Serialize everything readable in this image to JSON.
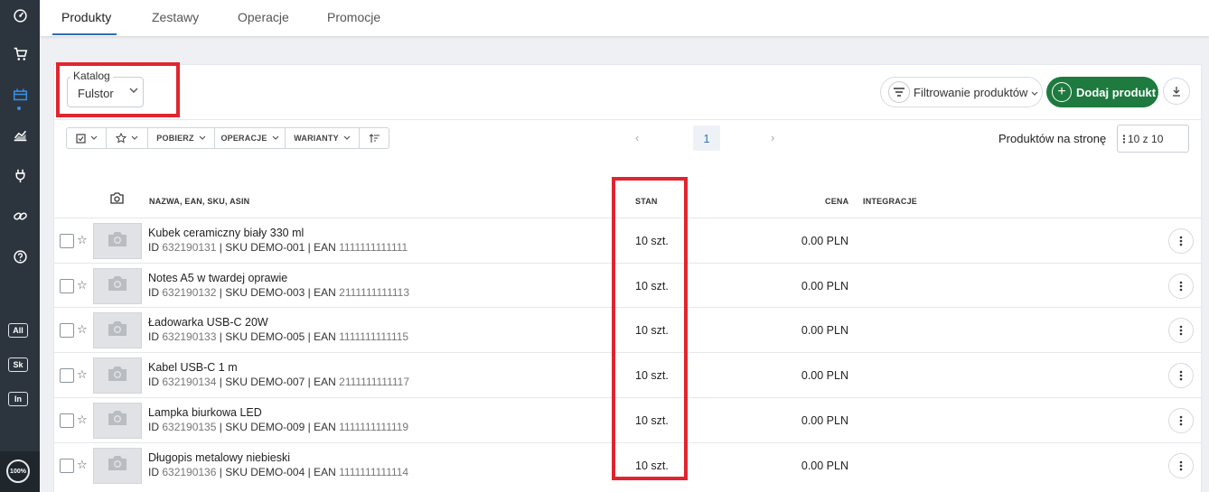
{
  "sidebar": {
    "items": [
      {
        "icon": "dashboard-icon"
      },
      {
        "icon": "cart-icon"
      },
      {
        "icon": "products-icon"
      },
      {
        "icon": "stats-icon"
      },
      {
        "icon": "plug-icon"
      },
      {
        "icon": "link-icon"
      },
      {
        "icon": "help-icon"
      }
    ],
    "tags": [
      "All",
      "Sk",
      "In"
    ],
    "progress": "100%"
  },
  "tabs": [
    "Produkty",
    "Zestawy",
    "Operacje",
    "Promocje"
  ],
  "catalog": {
    "legend": "Katalog",
    "value": "Fulstor"
  },
  "header_actions": {
    "filter_label": "Filtrowanie produktów",
    "add_label": "Dodaj produkt",
    "add_symbol": "+",
    "download_icon": "download-icon"
  },
  "toolbar": {
    "select_icon": "checkbox-icon",
    "favorite_icon": "star-icon",
    "pobierz": "POBIERZ",
    "operacje": "OPERACJE",
    "warianty": "WARIANTY",
    "sort_icon": "sort-icon"
  },
  "pagination": {
    "prev": "‹",
    "page": "1",
    "next": "›"
  },
  "per_page": {
    "label": "Produktów na stronę",
    "value": "10 z 10"
  },
  "columns": {
    "name": "NAZWA, EAN, SKU, ASIN",
    "stock": "STAN",
    "price": "CENA",
    "integrations": "INTEGRACJE"
  },
  "products": [
    {
      "name": "Kubek ceramiczny biały 330 ml",
      "id": "632190131",
      "sku": "DEMO-001",
      "ean": "1111111111111",
      "stock": "10 szt.",
      "price": "0.00 PLN"
    },
    {
      "name": "Notes A5 w twardej oprawie",
      "id": "632190132",
      "sku": "DEMO-003",
      "ean": "2111111111113",
      "stock": "10 szt.",
      "price": "0.00 PLN"
    },
    {
      "name": "Ładowarka USB-C 20W",
      "id": "632190133",
      "sku": "DEMO-005",
      "ean": "1111111111115",
      "stock": "10 szt.",
      "price": "0.00 PLN"
    },
    {
      "name": "Kabel USB-C 1 m",
      "id": "632190134",
      "sku": "DEMO-007",
      "ean": "2111111111117",
      "stock": "10 szt.",
      "price": "0.00 PLN"
    },
    {
      "name": "Lampka biurkowa LED",
      "id": "632190135",
      "sku": "DEMO-009",
      "ean": "1111111111119",
      "stock": "10 szt.",
      "price": "0.00 PLN"
    },
    {
      "name": "Długopis metalowy niebieski",
      "id": "632190136",
      "sku": "DEMO-004",
      "ean": "1111111111114",
      "stock": "10 szt.",
      "price": "0.00 PLN"
    }
  ],
  "labels": {
    "id": "ID",
    "sku": "SKU",
    "ean": "EAN",
    "sep": "|"
  },
  "colors": {
    "highlight": "#e0252f",
    "primary": "#1e7a3e",
    "accent": "#2f6fb0",
    "sidebar": "#2c353e"
  }
}
